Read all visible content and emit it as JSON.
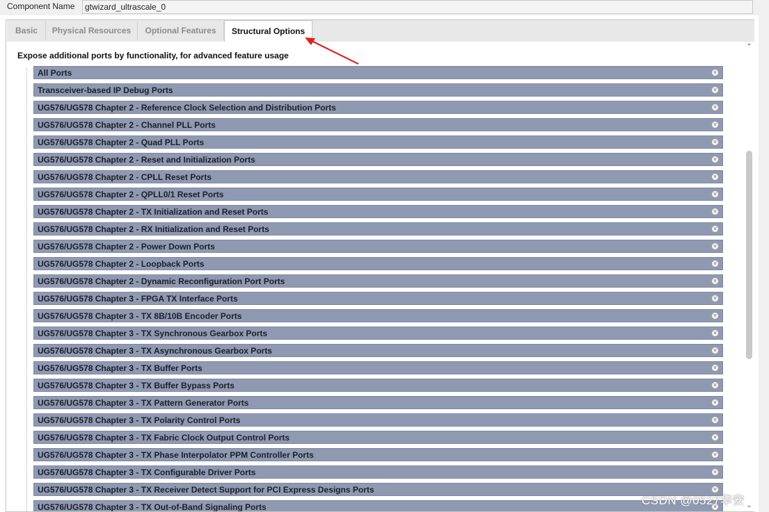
{
  "component": {
    "label": "Component Name",
    "value": "gtwizard_ultrascale_0"
  },
  "tabs": [
    "Basic",
    "Physical Resources",
    "Optional Features",
    "Structural Options"
  ],
  "active_tab": "Structural Options",
  "heading": "Expose additional ports by functionality, for advanced feature usage",
  "groups": [
    "All Ports",
    "Transceiver-based IP Debug Ports",
    "UG576/UG578 Chapter 2 - Reference Clock Selection and Distribution Ports",
    "UG576/UG578 Chapter 2 - Channel PLL Ports",
    "UG576/UG578 Chapter 2 - Quad PLL Ports",
    "UG576/UG578 Chapter 2 - Reset and Initialization Ports",
    "UG576/UG578 Chapter 2 - CPLL Reset Ports",
    "UG576/UG578 Chapter 2 - QPLL0/1 Reset Ports",
    "UG576/UG578 Chapter 2 - TX Initialization and Reset Ports",
    "UG576/UG578 Chapter 2 - RX Initialization and Reset Ports",
    "UG576/UG578 Chapter 2 - Power Down Ports",
    "UG576/UG578 Chapter 2 - Loopback Ports",
    "UG576/UG578 Chapter 2 - Dynamic Reconfiguration Port Ports",
    "UG576/UG578 Chapter 3 - FPGA TX Interface Ports",
    "UG576/UG578 Chapter 3 - TX 8B/10B Encoder Ports",
    "UG576/UG578 Chapter 3 - TX Synchronous Gearbox Ports",
    "UG576/UG578 Chapter 3 - TX Asynchronous Gearbox Ports",
    "UG576/UG578 Chapter 3 - TX Buffer Ports",
    "UG576/UG578 Chapter 3 - TX Buffer Bypass Ports",
    "UG576/UG578 Chapter 3 - TX Pattern Generator Ports",
    "UG576/UG578 Chapter 3 - TX Polarity Control Ports",
    "UG576/UG578 Chapter 3 - TX Fabric Clock Output Control Ports",
    "UG576/UG578 Chapter 3 - TX Phase Interpolator PPM Controller Ports",
    "UG576/UG578 Chapter 3 - TX Configurable Driver Ports",
    "UG576/UG578 Chapter 3 - TX Receiver Detect Support for PCI Express Designs Ports",
    "UG576/UG578 Chapter 3 - TX Out-of-Band Signaling Ports"
  ],
  "icons": {
    "expand": "chevron-down-circle-icon",
    "scroll_up": "chevron-up-icon",
    "scroll_down": "chevron-down-icon"
  },
  "annotation_color": "#e02020",
  "watermark": "CSDN @0527华安"
}
